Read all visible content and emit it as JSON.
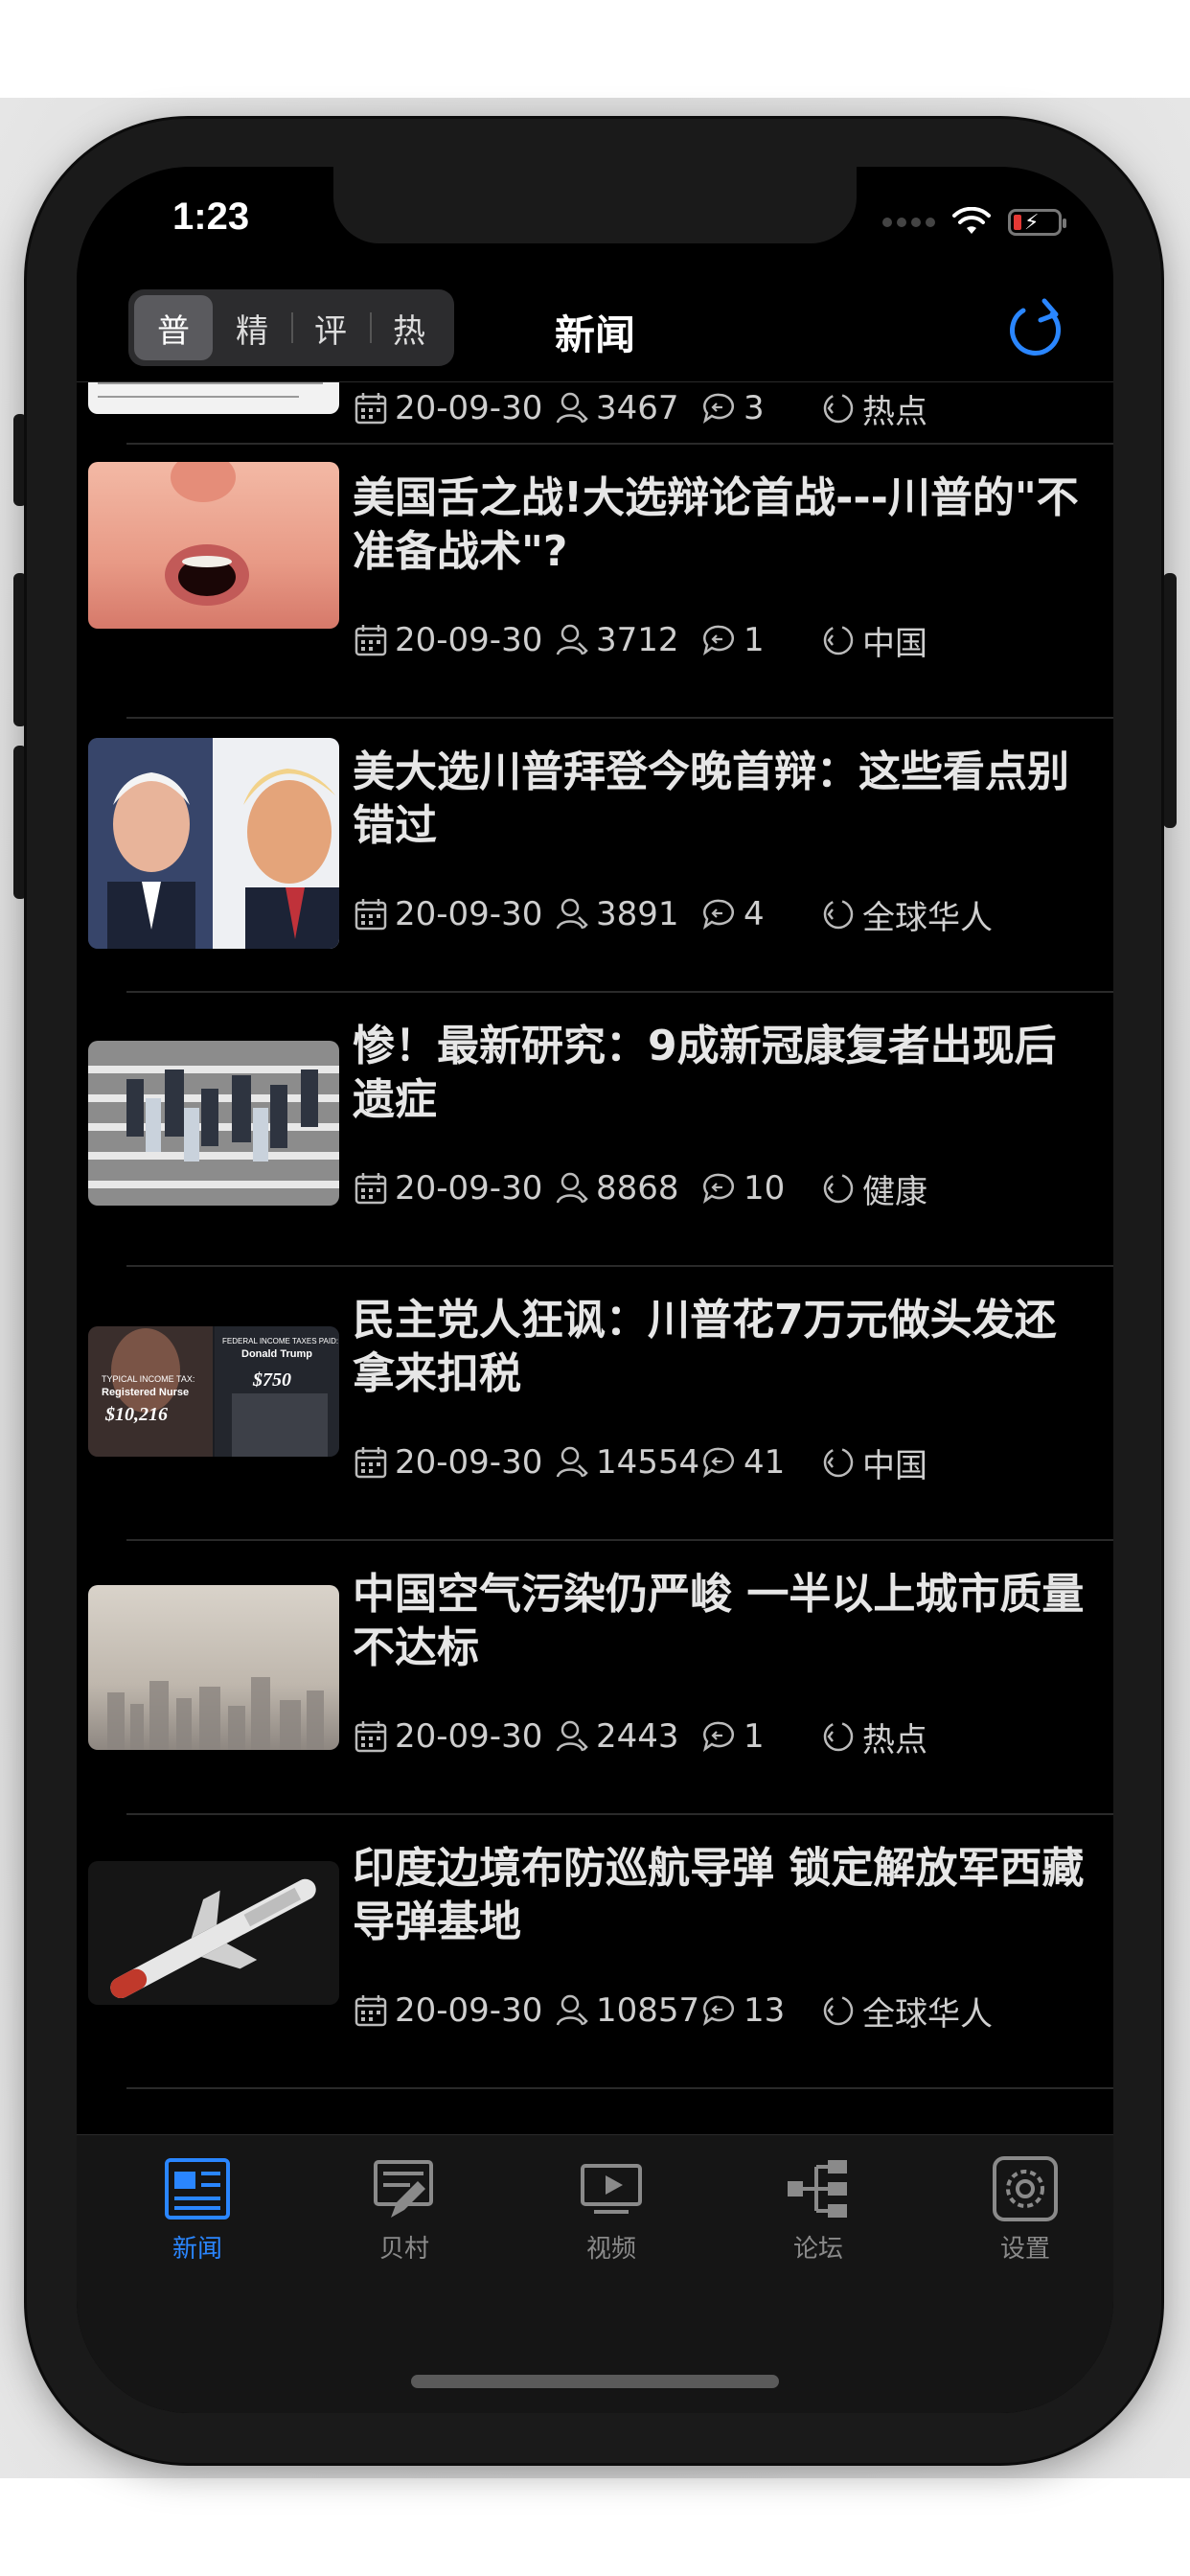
{
  "status": {
    "time": "1:23"
  },
  "nav": {
    "segments": [
      "普",
      "精",
      "评",
      "热"
    ],
    "selected_segment": 0,
    "title": "新闻"
  },
  "articles": [
    {
      "title": "...",
      "date": "20-09-30",
      "views": "3467",
      "comments": "3",
      "category": "热点"
    },
    {
      "title": "美国舌之战!大选辩论首战---川普的\"不准备战术\"?",
      "date": "20-09-30",
      "views": "3712",
      "comments": "1",
      "category": "中国"
    },
    {
      "title": "美大选川普拜登今晚首辩：这些看点别错过",
      "date": "20-09-30",
      "views": "3891",
      "comments": "4",
      "category": "全球华人"
    },
    {
      "title": "惨！最新研究：9成新冠康复者出现后遗症",
      "date": "20-09-30",
      "views": "8868",
      "comments": "10",
      "category": "健康"
    },
    {
      "title": "民主党人狂讽：川普花7万元做头发还拿来扣税",
      "date": "20-09-30",
      "views": "14554",
      "comments": "41",
      "category": "中国"
    },
    {
      "title": "中国空气污染仍严峻 一半以上城市质量不达标",
      "date": "20-09-30",
      "views": "2443",
      "comments": "1",
      "category": "热点"
    },
    {
      "title": "印度边境布防巡航导弹 锁定解放军西藏导弹基地",
      "date": "20-09-30",
      "views": "10857",
      "comments": "13",
      "category": "全球华人"
    }
  ],
  "thumbnails": {
    "nurse_card_title": "TYPICAL INCOME TAX:",
    "nurse_card_sub": "Registered Nurse",
    "nurse_card_value": "$10,216",
    "trump_card_title": "FEDERAL INCOME TAXES PAID:",
    "trump_card_sub": "Donald Trump",
    "trump_card_value": "$750"
  },
  "tabbar": {
    "tabs": [
      {
        "label": "新闻",
        "icon": "newspaper-icon",
        "active": true
      },
      {
        "label": "贝村",
        "icon": "edit-board-icon",
        "active": false
      },
      {
        "label": "视频",
        "icon": "video-icon",
        "active": false
      },
      {
        "label": "论坛",
        "icon": "forum-tree-icon",
        "active": false
      },
      {
        "label": "设置",
        "icon": "gear-icon",
        "active": false
      }
    ]
  },
  "colors": {
    "accent": "#2a86ff",
    "background": "#000000",
    "text": "#e6e6e6"
  }
}
